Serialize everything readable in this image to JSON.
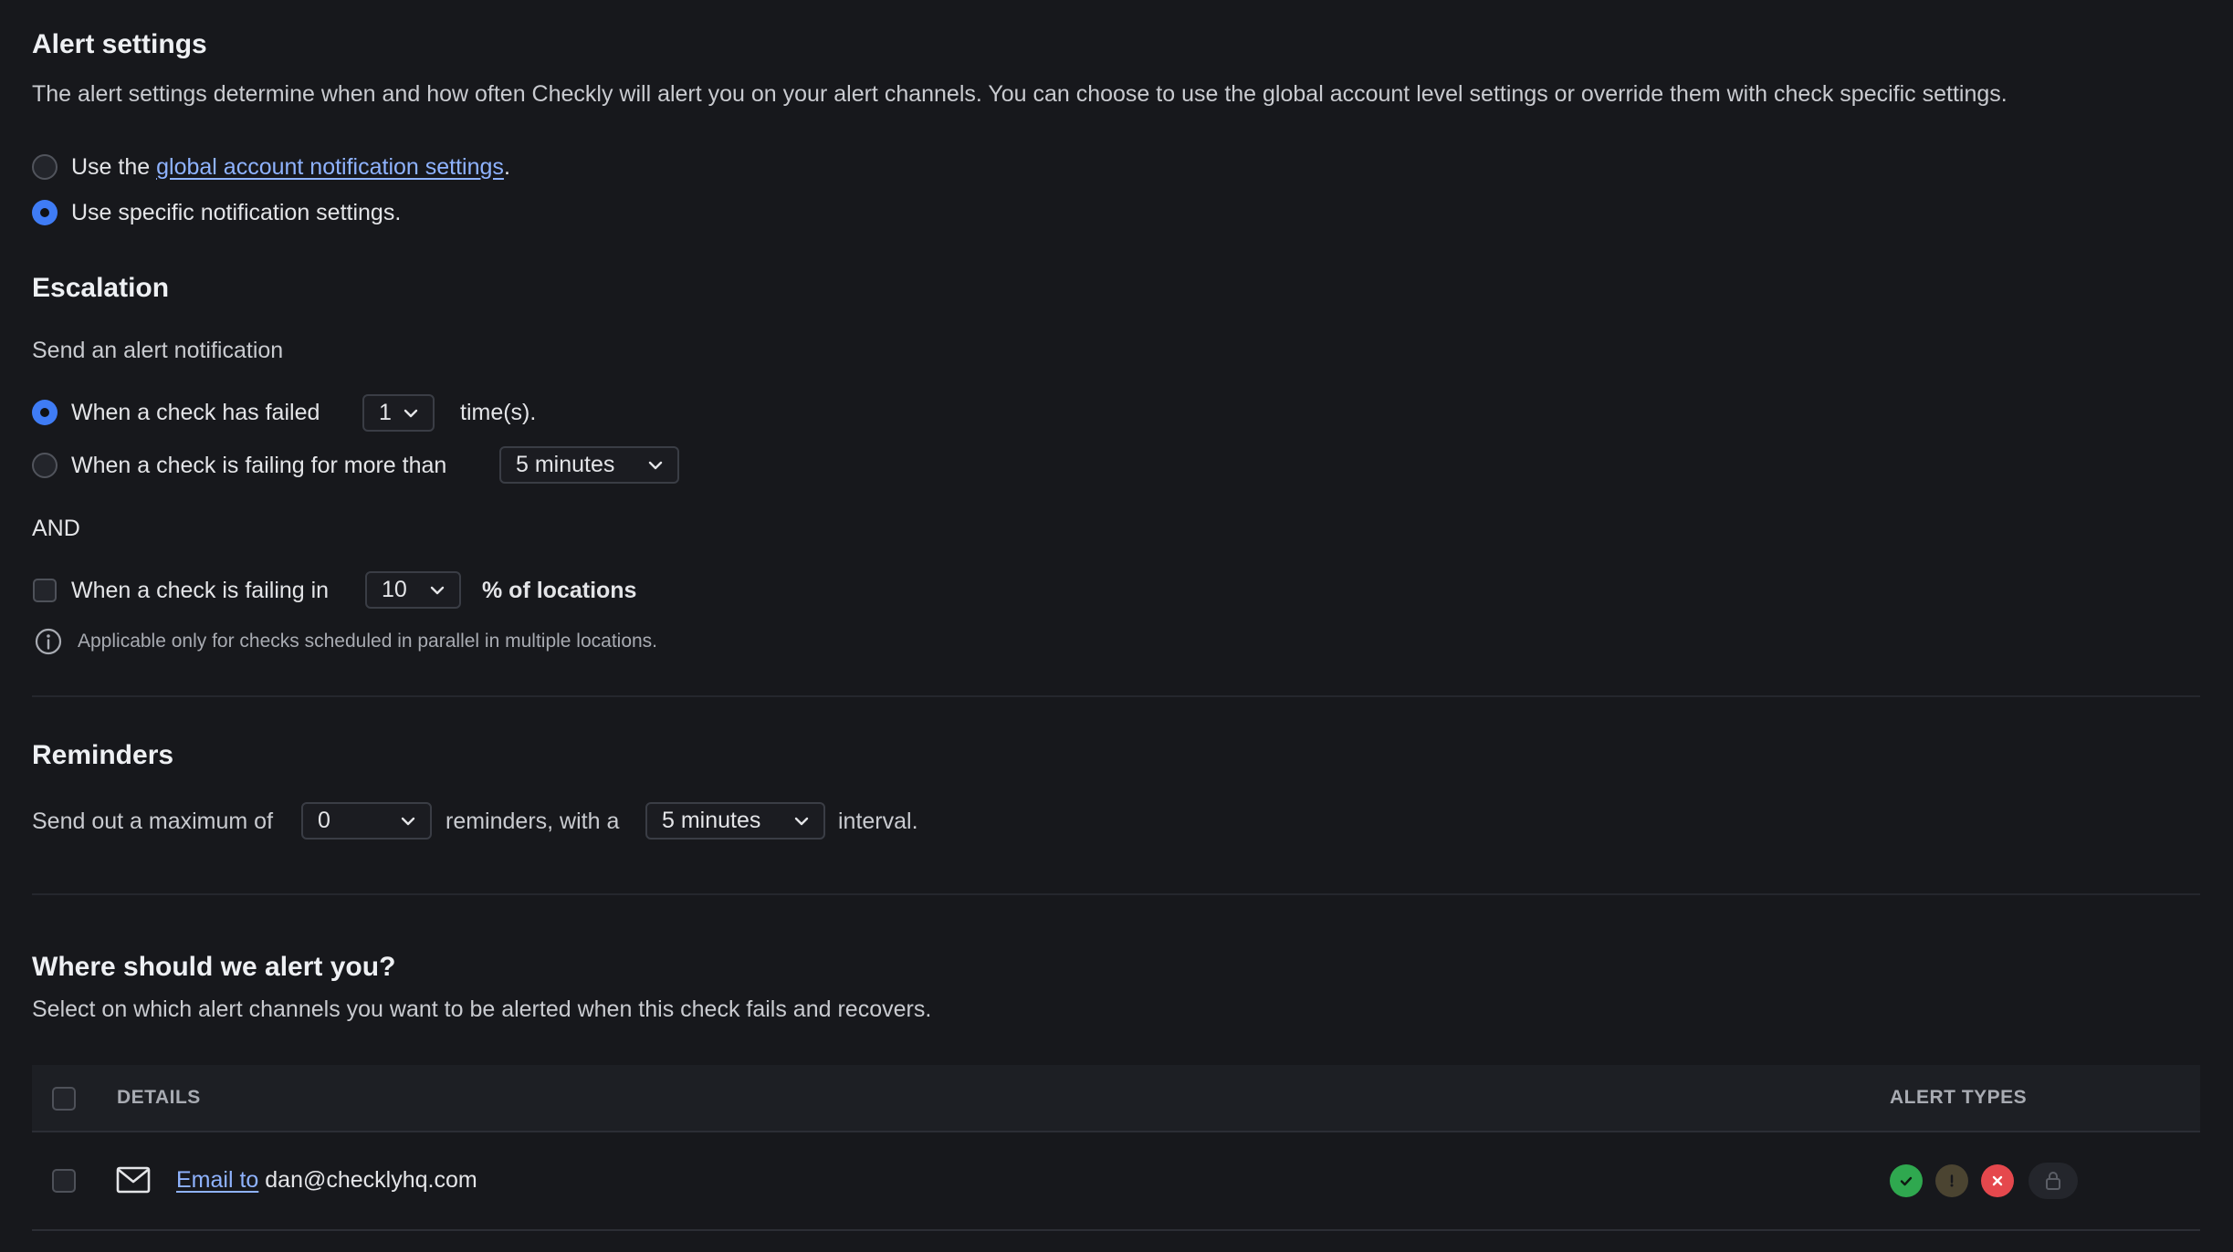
{
  "alert_settings": {
    "title": "Alert settings",
    "description": "The alert settings determine when and how often Checkly will alert you on your alert channels. You can choose to use the global account level settings or override them with check specific settings.",
    "option_global_prefix": "Use the",
    "option_global_link": "global account notification settings",
    "option_global_suffix": ".",
    "option_specific": "Use specific notification settings.",
    "selected": "specific"
  },
  "escalation": {
    "title": "Escalation",
    "subtitle": "Send an alert notification",
    "failed_label": "When a check has failed",
    "failed_count": "1",
    "failed_suffix": "time(s).",
    "failing_for_label": "When a check is failing for more than",
    "failing_for_value": "5 minutes",
    "and_label": "AND",
    "locations_label": "When a check is failing in",
    "locations_value": "10",
    "locations_suffix": "% of locations",
    "info_note": "Applicable only for checks scheduled in parallel in multiple locations."
  },
  "reminders": {
    "title": "Reminders",
    "prefix": "Send out a maximum of",
    "max_value": "0",
    "middle": "reminders, with a",
    "interval_value": "5 minutes",
    "suffix": "interval."
  },
  "channels": {
    "title": "Where should we alert you?",
    "description": "Select on which alert channels you want to be alerted when this check fails and recovers.",
    "col_details": "DETAILS",
    "col_alert_types": "ALERT TYPES",
    "rows": [
      {
        "link_text": "Email to",
        "target": "dan@checklyhq.com",
        "icon": "mail-icon"
      }
    ],
    "alert_type_icons": [
      "recovery-check-icon",
      "degraded-warning-icon",
      "failure-x-icon",
      "lock-icon"
    ]
  },
  "colors": {
    "background": "#17181c",
    "accent": "#3f7cf5",
    "link": "#8fb3ff",
    "success": "#2fa84f",
    "warning": "#4b4431",
    "danger": "#e5484d"
  }
}
